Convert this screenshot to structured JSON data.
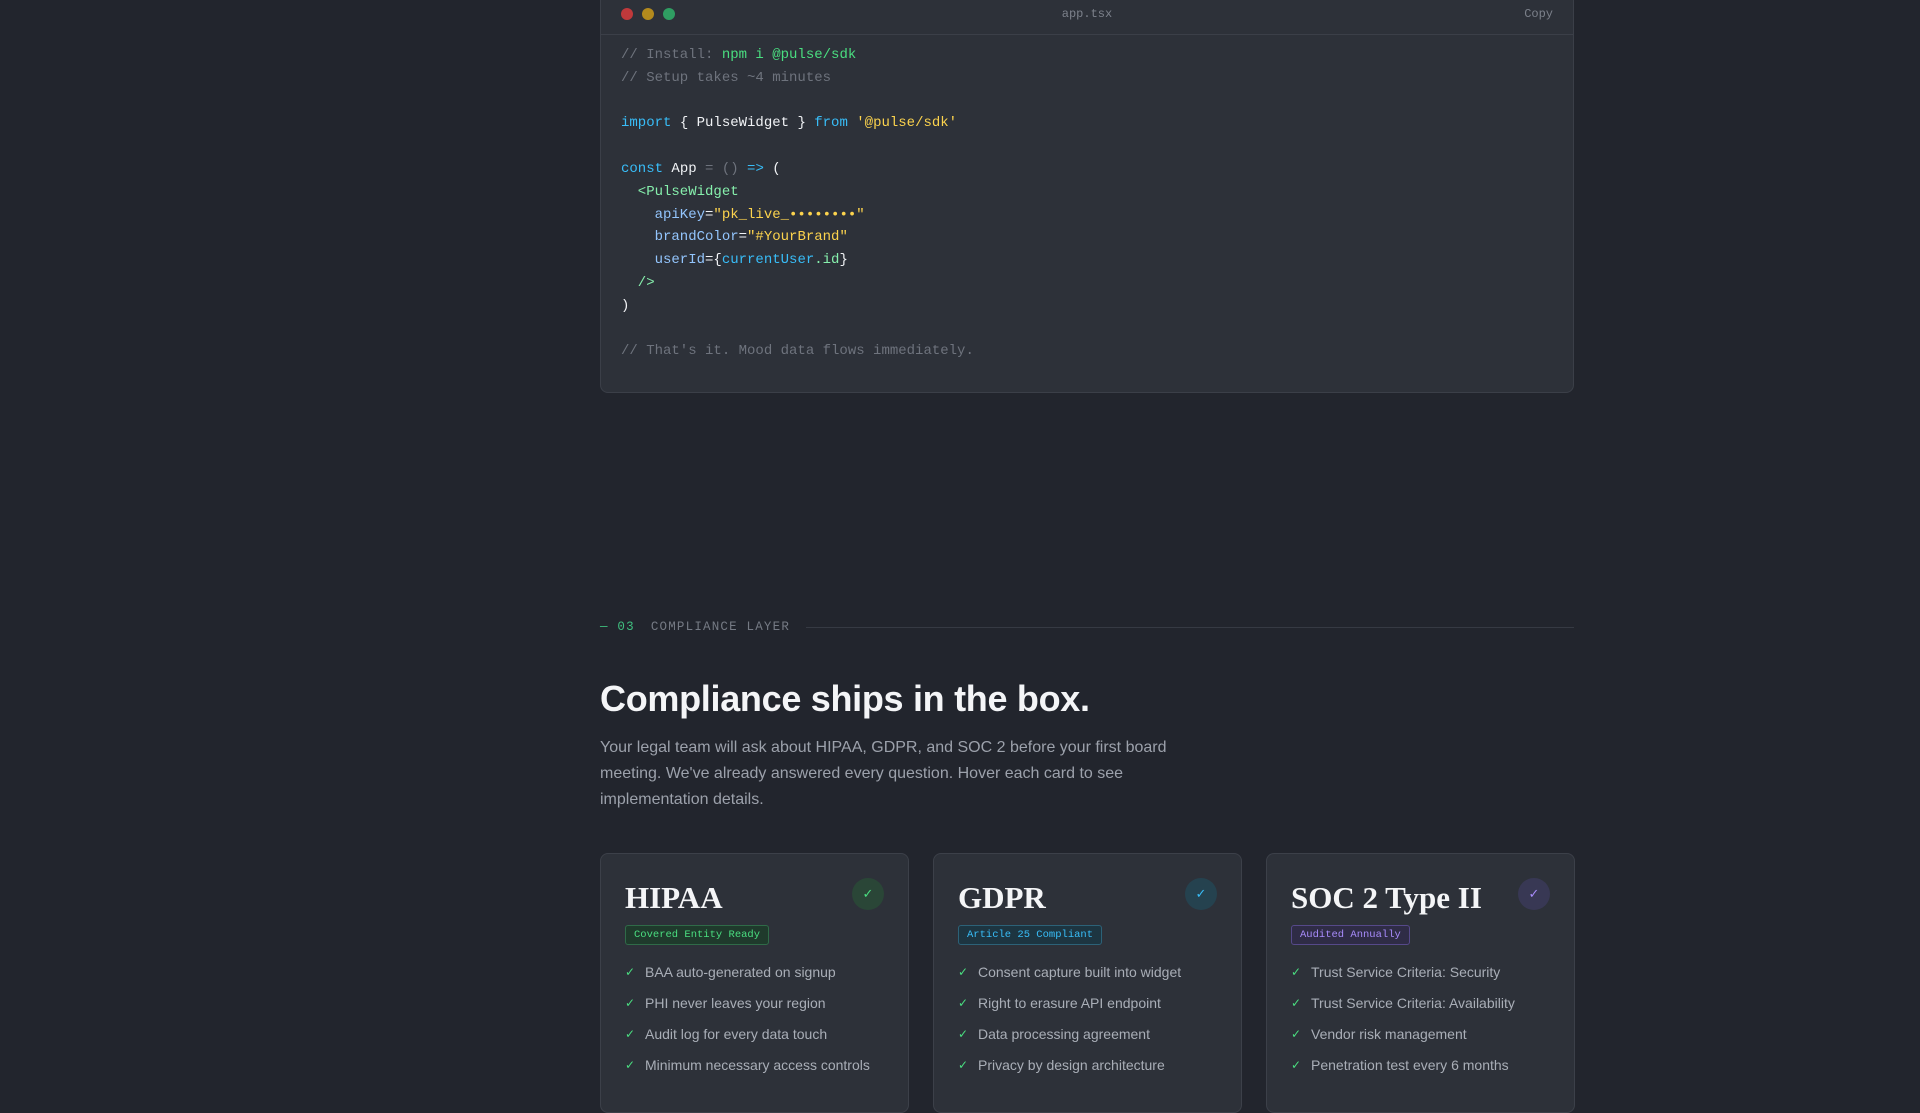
{
  "code_window": {
    "filename": "app.tsx",
    "copy_label": "Copy",
    "colors": {
      "close": "#c0393b",
      "minimize": "#b38a1d",
      "maximize": "#2f9e62"
    },
    "lines": [
      [
        {
          "t": "// Install: ",
          "c": "comment"
        },
        {
          "t": "npm i @pulse/sdk",
          "c": "green"
        }
      ],
      [
        {
          "t": "// Setup takes ~4 minutes",
          "c": "comment"
        }
      ],
      [],
      [
        {
          "t": "import",
          "c": "blue"
        },
        {
          "t": " { PulseWidget } ",
          "c": "white"
        },
        {
          "t": "from",
          "c": "blue"
        },
        {
          "t": " ",
          "c": "white"
        },
        {
          "t": "'@pulse/sdk'",
          "c": "yellow"
        }
      ],
      [],
      [
        {
          "t": "const",
          "c": "blue"
        },
        {
          "t": " App ",
          "c": "white"
        },
        {
          "t": "= () ",
          "c": "gray"
        },
        {
          "t": "=>",
          "c": "blue"
        },
        {
          "t": " (",
          "c": "white"
        }
      ],
      [
        {
          "t": "  <PulseWidget",
          "c": "tag"
        }
      ],
      [
        {
          "t": "    apiKey",
          "c": "attr"
        },
        {
          "t": "=",
          "c": "white"
        },
        {
          "t": "\"pk_live_••••••••\"",
          "c": "yellow"
        }
      ],
      [
        {
          "t": "    brandColor",
          "c": "attr"
        },
        {
          "t": "=",
          "c": "white"
        },
        {
          "t": "\"#YourBrand\"",
          "c": "yellow"
        }
      ],
      [
        {
          "t": "    userId",
          "c": "attr"
        },
        {
          "t": "={",
          "c": "white"
        },
        {
          "t": "currentUser",
          "c": "blue"
        },
        {
          "t": ".id",
          "c": "tag"
        },
        {
          "t": "}",
          "c": "white"
        }
      ],
      [
        {
          "t": "  />",
          "c": "tag"
        }
      ],
      [
        {
          "t": ")",
          "c": "white"
        }
      ],
      [],
      [
        {
          "t": "// That's it. Mood data flows immediately.",
          "c": "comment"
        }
      ]
    ]
  },
  "section": {
    "number": "— 03",
    "label": "COMPLIANCE LAYER",
    "headline": "Compliance ships in the box.",
    "lede": "Your legal team will ask about HIPAA, GDPR, and SOC 2 before your first board meeting. We've already answered every question. Hover each card to see implementation details."
  },
  "cards": [
    {
      "title": "HIPAA",
      "badge": "Covered Entity Ready",
      "icon": "check-icon",
      "check": "✓",
      "accent": "#4ade80",
      "badge_bg": "#1f3a2c",
      "badge_border": "#2f6b48",
      "check_bg": "#2a4637",
      "items": [
        "BAA auto-generated on signup",
        "PHI never leaves your region",
        "Audit log for every data touch",
        "Minimum necessary access controls"
      ]
    },
    {
      "title": "GDPR",
      "badge": "Article 25 Compliant",
      "icon": "check-icon",
      "check": "✓",
      "accent": "#38bdf8",
      "badge_bg": "#1d3541",
      "badge_border": "#2c6278",
      "check_bg": "#25424f",
      "items": [
        "Consent capture built into widget",
        "Right to erasure API endpoint",
        "Data processing agreement",
        "Privacy by design architecture"
      ]
    },
    {
      "title": "SOC 2 Type II",
      "badge": "Audited Annually",
      "icon": "check-icon",
      "check": "✓",
      "accent": "#a78bfa",
      "badge_bg": "#2f2c46",
      "badge_border": "#56498a",
      "check_bg": "#383854",
      "items": [
        "Trust Service Criteria: Security",
        "Trust Service Criteria: Availability",
        "Vendor risk management",
        "Penetration test every 6 months"
      ]
    }
  ],
  "list_check": "✓",
  "list_check_color": "#4ade80"
}
